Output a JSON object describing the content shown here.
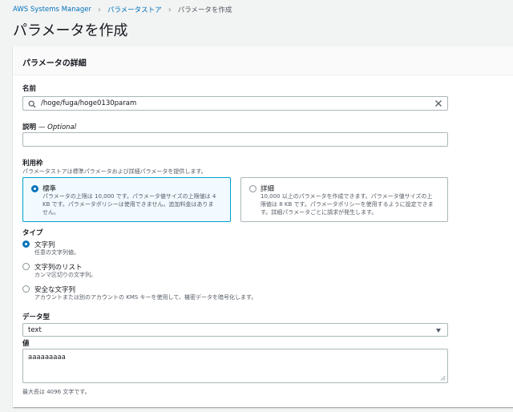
{
  "breadcrumb": {
    "items": [
      "AWS Systems Manager",
      "パラメータストア",
      "パラメータを作成"
    ]
  },
  "page": {
    "title": "パラメータを作成"
  },
  "panel": {
    "title": "パラメータの詳細",
    "name": {
      "label": "名前",
      "value": "/hoge/fuga/hoge0130param"
    },
    "description": {
      "label": "説明",
      "optional": "— Optional",
      "value": ""
    },
    "tier": {
      "label": "利用枠",
      "description": "パラメータストアは標準パラメータおよび詳細パラメータを提供します。",
      "options": [
        {
          "title": "標準",
          "description_lines": [
            "パラメータの上限は 10,000 です。パラメータ値サイズの上限値は 4",
            "KB です。パラメータポリシーは使用できません。追加料金はありま",
            "せん。"
          ],
          "selected": true
        },
        {
          "title": "詳細",
          "description_lines": [
            "10,000 以上のパラメータを作成できます。パラメータ値サイズの上",
            "限値は 8 KB です。パラメータポリシーを使用するように設定できま",
            "す。詳細パラメータごとに請求が発生します。"
          ],
          "selected": false
        }
      ]
    },
    "type": {
      "label": "タイプ",
      "options": [
        {
          "title": "文字列",
          "description": "任意の文字列値。",
          "selected": true
        },
        {
          "title": "文字列のリスト",
          "description": "カンマ区切りの文字列。",
          "selected": false
        },
        {
          "title": "安全な文字列",
          "description": "アカウントまたは別のアカウントの KMS キーを使用して、機密データを暗号化します。",
          "selected": false
        }
      ]
    },
    "data_type": {
      "label": "データ型",
      "value": "text"
    },
    "value": {
      "label": "値",
      "value": "aaaaaaaaa",
      "hint": "最大長は 4096 文字です。"
    }
  },
  "colors": {
    "link": "#0073bb",
    "selected_border": "#00a1c9",
    "selected_bg": "#f1faff"
  }
}
